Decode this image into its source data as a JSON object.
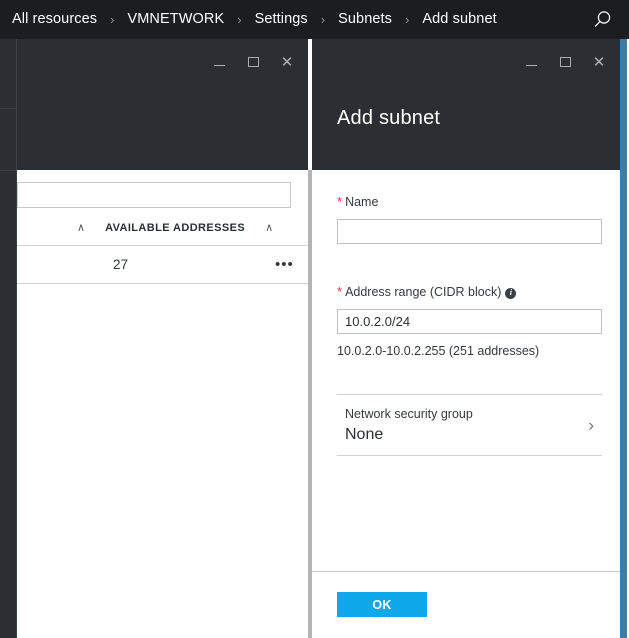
{
  "topbar": {
    "breadcrumbs": [
      {
        "label": "All resources"
      },
      {
        "label": "VMNETWORK"
      },
      {
        "label": "Settings"
      },
      {
        "label": "Subnets"
      },
      {
        "label": "Add subnet"
      }
    ],
    "separator": "›",
    "search_icon": "search-icon"
  },
  "window_controls": {
    "minimize": "—",
    "maximize": "□",
    "close": "✕"
  },
  "left_blade": {
    "search": {
      "value": "",
      "placeholder": ""
    },
    "table": {
      "columns": [
        "AVAILABLE ADDRESSES"
      ],
      "sort_caret": "∧",
      "rows": [
        {
          "available_addresses": "27",
          "menu": "•••"
        }
      ]
    }
  },
  "right_blade": {
    "title": "Add subnet",
    "fields": {
      "name": {
        "label": "Name",
        "required_marker": "*",
        "value": "",
        "placeholder": ""
      },
      "address_range": {
        "label": "Address range (CIDR block)",
        "required_marker": "*",
        "info_icon": "i",
        "value": "10.0.2.0/24",
        "helper": "10.0.2.0-10.0.2.255 (251 addresses)"
      },
      "network_security_group": {
        "label": "Network security group",
        "value": "None",
        "chevron": "›"
      }
    },
    "ok_label": "OK"
  },
  "colors": {
    "topbar_bg": "#1b1d21",
    "blade_header_bg": "#2b2f33",
    "accent_blue": "#0fa8e8",
    "edge_bar": "#3e7ca3",
    "required_red": "#e8284a"
  }
}
